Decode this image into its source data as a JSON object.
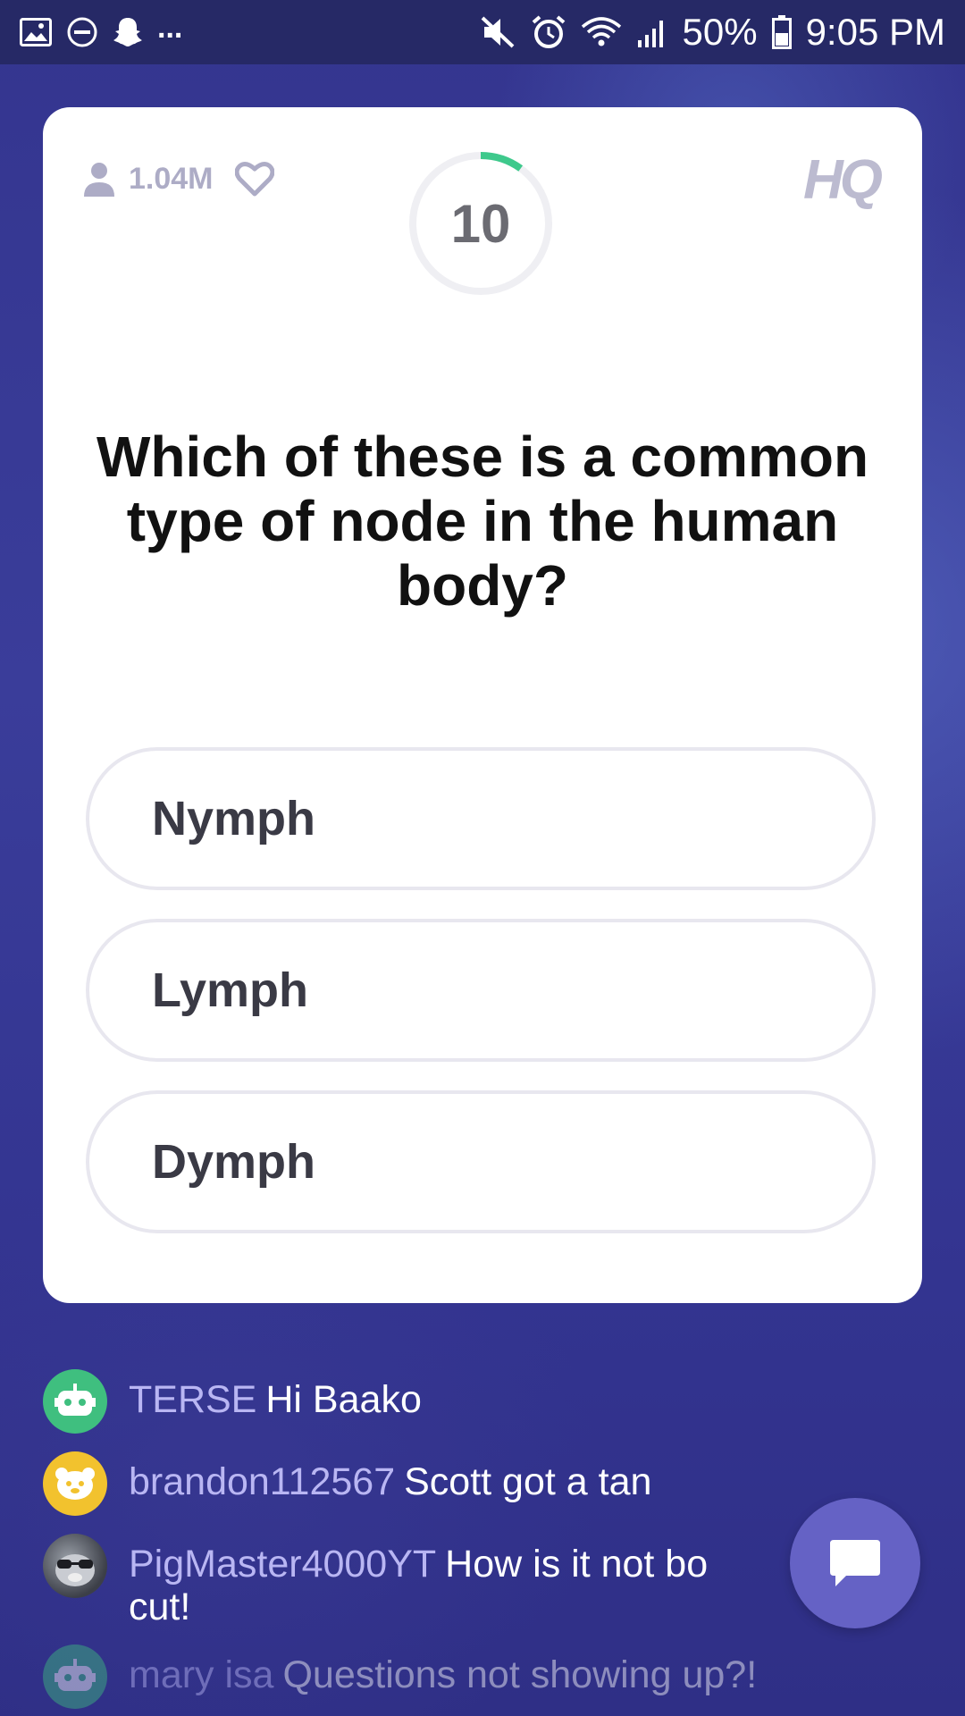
{
  "status_bar": {
    "battery_text": "50%",
    "time": "9:05 PM",
    "more_indicator": "..."
  },
  "game": {
    "viewer_count": "1.04M",
    "timer_value": "10",
    "timer_progress": 0.1,
    "logo_text": "HQ",
    "accent_color": "#3ec98c"
  },
  "question": {
    "text": "Which of these is a common type of node in the human body?"
  },
  "answers": [
    {
      "label": "Nymph"
    },
    {
      "label": "Lymph"
    },
    {
      "label": "Dymph"
    }
  ],
  "chat": [
    {
      "username": "TERSE",
      "message": "Hi Baako",
      "avatar_color": "#3fbf7f",
      "avatar_icon": "robot-icon"
    },
    {
      "username": "brandon112567",
      "message": "Scott got a tan",
      "avatar_color": "#f2c22e",
      "avatar_icon": "bear-icon"
    },
    {
      "username": "PigMaster4000YT",
      "message": "How is it not bo cut!",
      "avatar_color": "#555a66",
      "avatar_icon": "photo-avatar"
    },
    {
      "username": "mary isa",
      "message": "Questions not showing up?!",
      "avatar_color": "#3fbf7f",
      "avatar_icon": "robot-icon"
    }
  ]
}
